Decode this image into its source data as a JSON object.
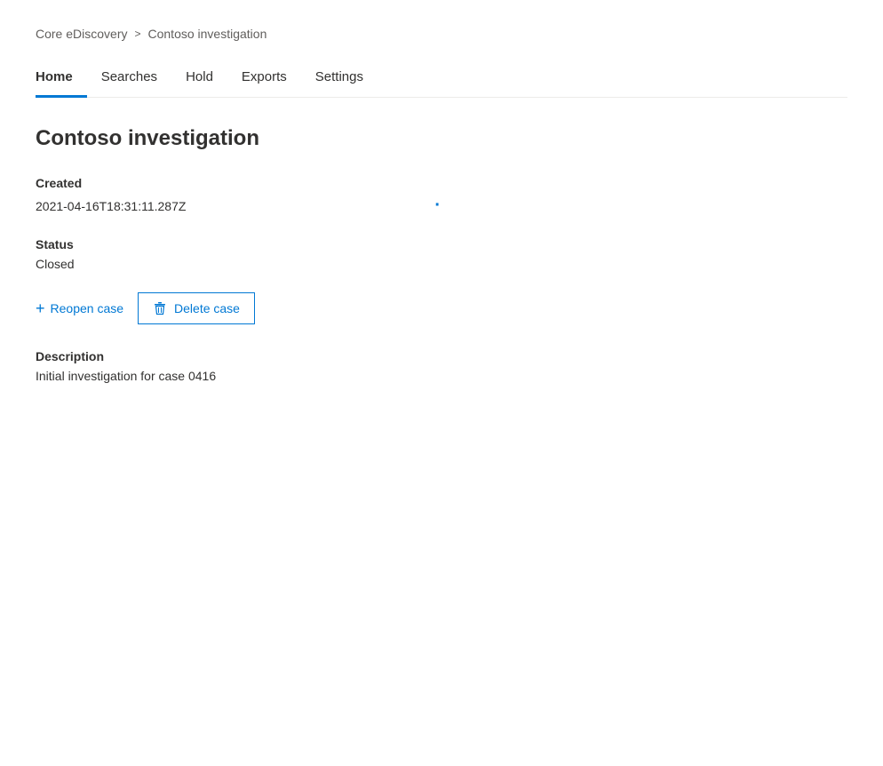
{
  "breadcrumb": {
    "parent": "Core eDiscovery",
    "separator": ">",
    "current": "Contoso investigation"
  },
  "tabs": [
    {
      "id": "home",
      "label": "Home",
      "active": true
    },
    {
      "id": "searches",
      "label": "Searches",
      "active": false
    },
    {
      "id": "hold",
      "label": "Hold",
      "active": false
    },
    {
      "id": "exports",
      "label": "Exports",
      "active": false
    },
    {
      "id": "settings",
      "label": "Settings",
      "active": false
    }
  ],
  "page": {
    "title": "Contoso investigation",
    "created_label": "Created",
    "created_value": "2021-04-16T18:31:11.287Z",
    "status_label": "Status",
    "status_value": "Closed",
    "reopen_label": "Reopen case",
    "delete_label": "Delete case",
    "description_label": "Description",
    "description_value": "Initial investigation for case 0416"
  },
  "icons": {
    "plus": "+",
    "trash": "🗑",
    "chevron": "›"
  },
  "colors": {
    "accent": "#0078d4",
    "text_primary": "#323130",
    "text_secondary": "#605e5c",
    "tab_active_border": "#0078d4"
  }
}
